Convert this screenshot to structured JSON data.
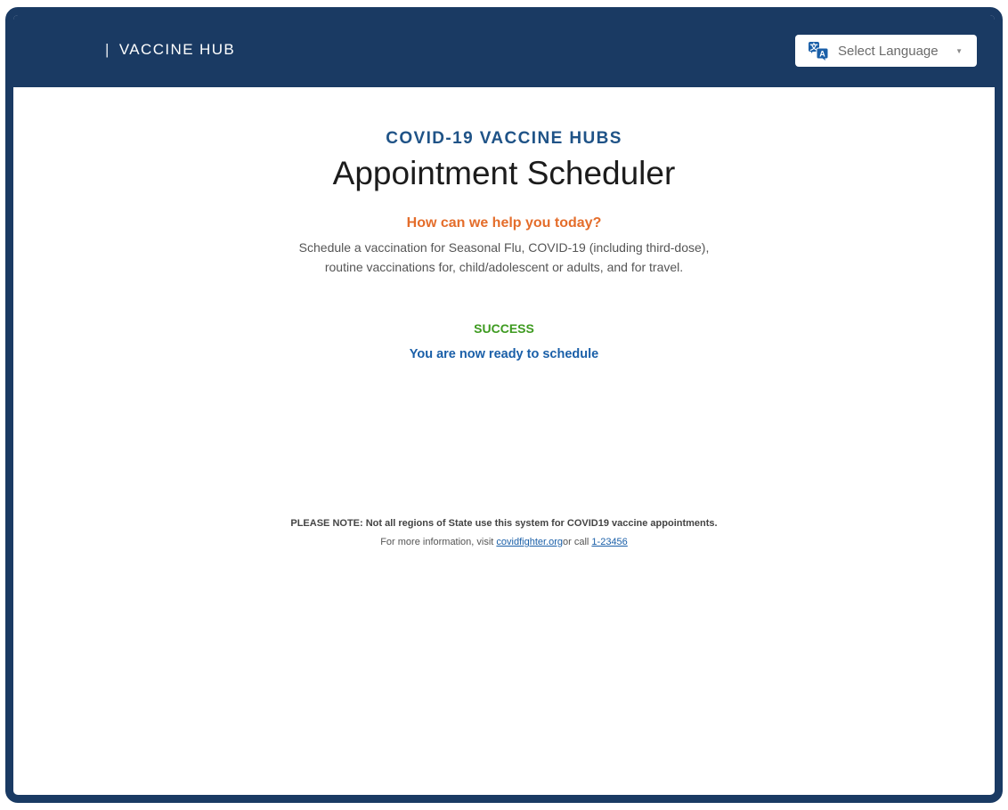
{
  "header": {
    "separator": "|",
    "brand": "VACCINE HUB",
    "language_select": {
      "icon": "translate-icon",
      "label": "Select Language",
      "caret": "▼"
    }
  },
  "main": {
    "eyebrow": "COVID-19 VACCINE HUBS",
    "title": "Appointment Scheduler",
    "help_heading": "How can we help you today?",
    "description_line1": "Schedule a vaccination for Seasonal Flu, COVID-19 (including third-dose),",
    "description_line2": "routine vaccinations for, child/adolescent or adults, and for travel.",
    "status": "SUCCESS",
    "status_message": "You are now ready to schedule"
  },
  "footer_note": {
    "note": "PLEASE NOTE: Not all regions of State use this system for COVID19 vaccine appointments.",
    "info_prefix": "For more information, visit ",
    "site_link": "covidfighter.org",
    "call_text": "or call ",
    "phone_link": "1-23456"
  },
  "colors": {
    "header_bg": "#1a3a63",
    "eyebrow": "#1f5387",
    "help_heading": "#e46d2b",
    "success": "#3d9a1f",
    "link": "#1a5fa8"
  }
}
